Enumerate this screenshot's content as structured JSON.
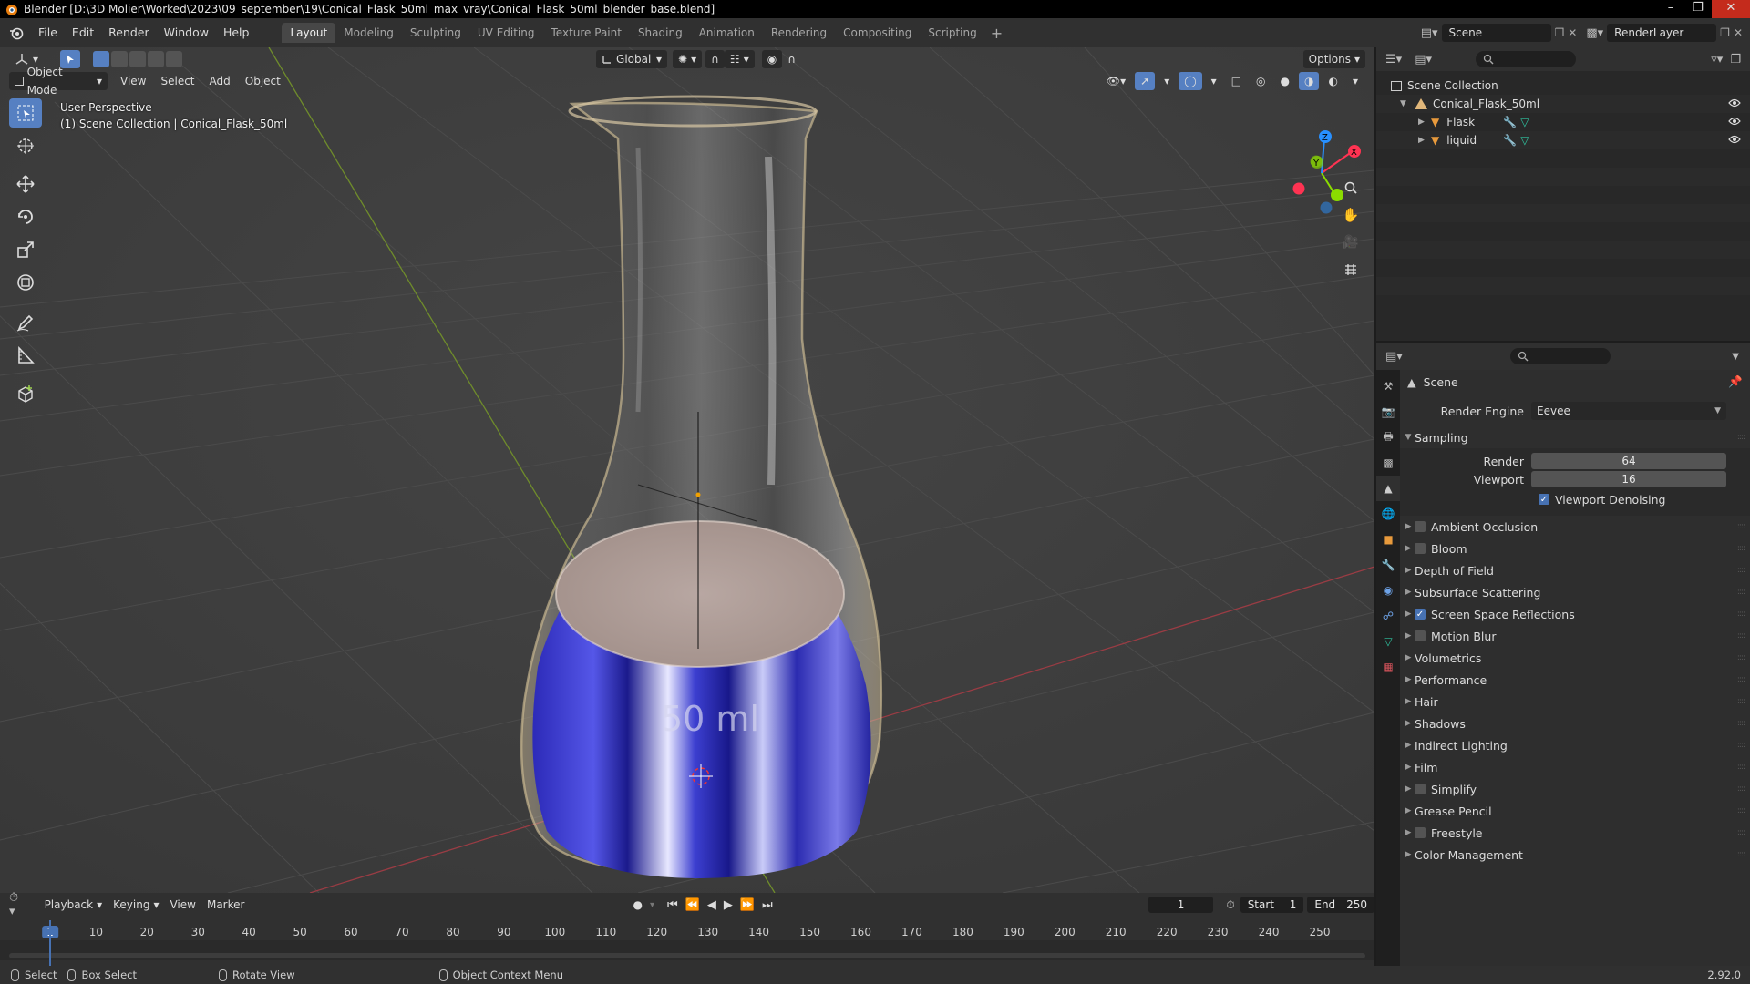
{
  "title_bar": {
    "text": "Blender [D:\\3D Molier\\Worked\\2023\\09_september\\19\\Conical_Flask_50ml_max_vray\\Conical_Flask_50ml_blender_base.blend]"
  },
  "menu": [
    "File",
    "Edit",
    "Render",
    "Window",
    "Help"
  ],
  "workspaces": [
    "Layout",
    "Modeling",
    "Sculpting",
    "UV Editing",
    "Texture Paint",
    "Shading",
    "Animation",
    "Rendering",
    "Compositing",
    "Scripting"
  ],
  "active_workspace": "Layout",
  "scene": {
    "name": "Scene",
    "view_layer": "RenderLayer"
  },
  "viewport": {
    "mode": "Object Mode",
    "header_menus": [
      "View",
      "Select",
      "Add",
      "Object"
    ],
    "transform_orientation": "Global",
    "options_label": "Options",
    "info_line1": "User Perspective",
    "info_line2": "(1) Scene Collection | Conical_Flask_50ml",
    "flask_label": "50 ml",
    "gizmo_axes": {
      "x": "X",
      "y": "Y",
      "z": "Z"
    }
  },
  "outliner": {
    "root": "Scene Collection",
    "items": [
      {
        "label": "Conical_Flask_50ml",
        "level": 1,
        "expanded": true
      },
      {
        "label": "Flask",
        "level": 2,
        "expanded": false
      },
      {
        "label": "liquid",
        "level": 2,
        "expanded": false
      }
    ]
  },
  "properties": {
    "context": "Scene",
    "render_engine_label": "Render Engine",
    "render_engine": "Eevee",
    "sampling": {
      "title": "Sampling",
      "render_label": "Render",
      "render": "64",
      "viewport_label": "Viewport",
      "viewport": "16",
      "denoise_label": "Viewport Denoising",
      "denoise": true
    },
    "sections": [
      {
        "label": "Ambient Occlusion",
        "checkbox": true,
        "checked": false
      },
      {
        "label": "Bloom",
        "checkbox": true,
        "checked": false
      },
      {
        "label": "Depth of Field",
        "checkbox": false,
        "checked": false
      },
      {
        "label": "Subsurface Scattering",
        "checkbox": false,
        "checked": false
      },
      {
        "label": "Screen Space Reflections",
        "checkbox": true,
        "checked": true
      },
      {
        "label": "Motion Blur",
        "checkbox": true,
        "checked": false
      },
      {
        "label": "Volumetrics",
        "checkbox": false,
        "checked": false
      },
      {
        "label": "Performance",
        "checkbox": false,
        "checked": false
      },
      {
        "label": "Hair",
        "checkbox": false,
        "checked": false
      },
      {
        "label": "Shadows",
        "checkbox": false,
        "checked": false
      },
      {
        "label": "Indirect Lighting",
        "checkbox": false,
        "checked": false
      },
      {
        "label": "Film",
        "checkbox": false,
        "checked": false
      },
      {
        "label": "Simplify",
        "checkbox": true,
        "checked": false
      },
      {
        "label": "Grease Pencil",
        "checkbox": false,
        "checked": false
      },
      {
        "label": "Freestyle",
        "checkbox": true,
        "checked": false
      },
      {
        "label": "Color Management",
        "checkbox": false,
        "checked": false
      }
    ]
  },
  "timeline": {
    "menus": [
      "Playback",
      "Keying",
      "View",
      "Marker"
    ],
    "current_frame": "1",
    "start_label": "Start",
    "start": "1",
    "end_label": "End",
    "end": "250",
    "ticks": [
      "1",
      "10",
      "20",
      "30",
      "40",
      "50",
      "60",
      "70",
      "80",
      "90",
      "100",
      "110",
      "120",
      "130",
      "140",
      "150",
      "160",
      "170",
      "180",
      "190",
      "200",
      "210",
      "220",
      "230",
      "240",
      "250"
    ]
  },
  "status_bar": {
    "select": "Select",
    "box_select": "Box Select",
    "rotate_view": "Rotate View",
    "context_menu": "Object Context Menu",
    "version": "2.92.0"
  },
  "colors": {
    "accent": "#4772b3",
    "active_tool": "#5680c2",
    "x_axis": "#ff3352",
    "y_axis": "#8bdc00",
    "z_axis": "#2890ff"
  }
}
